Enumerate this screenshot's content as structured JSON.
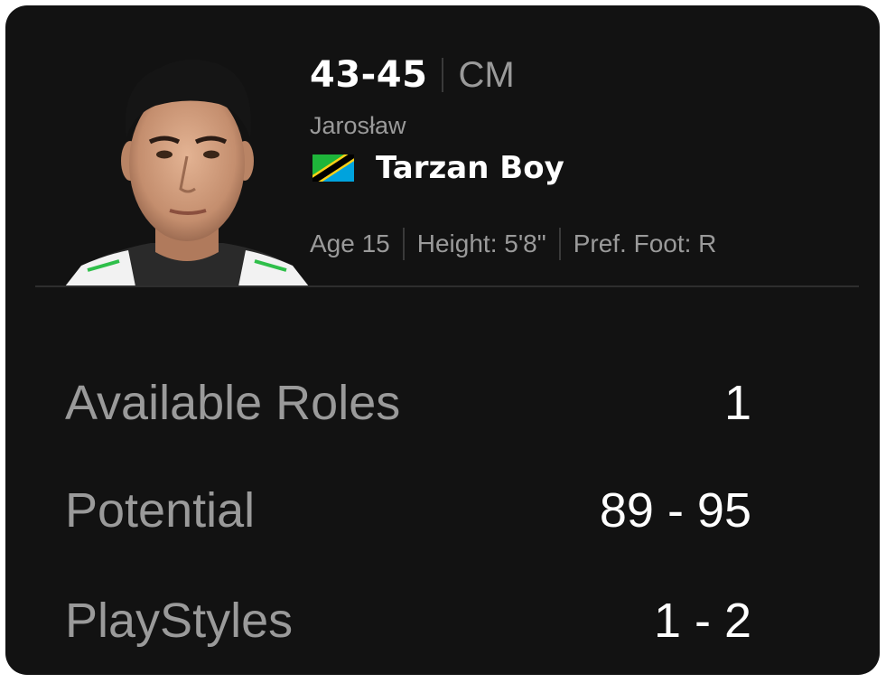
{
  "player": {
    "rating": "43-45",
    "position": "CM",
    "first_name": "Jarosław",
    "last_name": "Tarzan Boy",
    "nationality_flag_icon": "tanzania-flag-icon",
    "age": "Age 15",
    "height": "Height: 5'8\"",
    "pref_foot": "Pref. Foot: R"
  },
  "stats": [
    {
      "label": "Available Roles",
      "value": "1"
    },
    {
      "label": "Potential",
      "value": "89 - 95"
    },
    {
      "label": "PlayStyles",
      "value": "1 - 2"
    }
  ],
  "colors": {
    "card_background": "#121212",
    "primary_text": "#ffffff",
    "secondary_text": "#9a9a9a",
    "divider": "#2e2e2e"
  }
}
